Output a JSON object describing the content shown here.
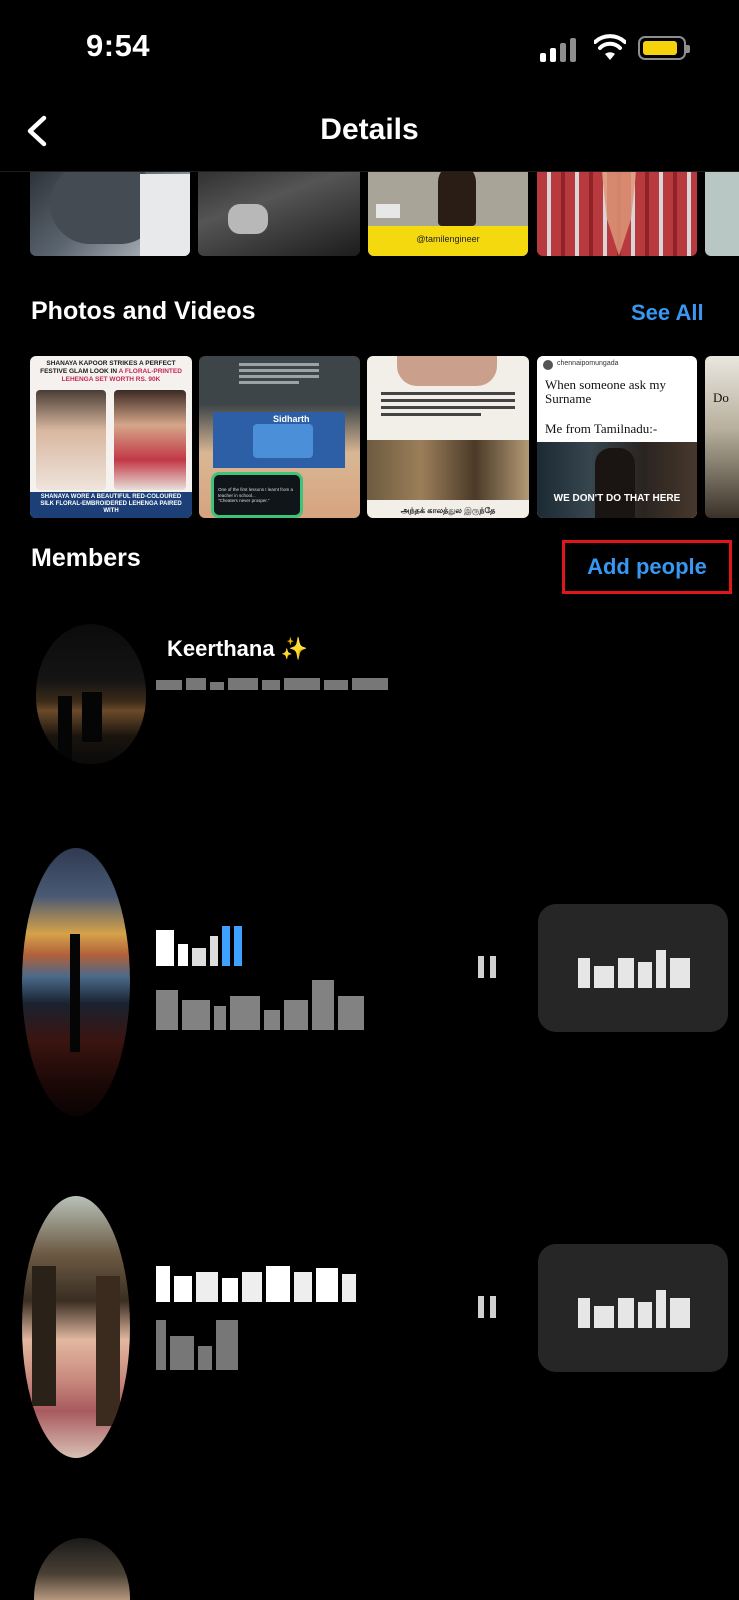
{
  "status_bar": {
    "time": "9:54",
    "battery_color": "#f5d20c"
  },
  "header": {
    "title": "Details",
    "back_icon": "chevron-left-icon"
  },
  "top_strip": {
    "items": [
      {
        "caption": ""
      },
      {
        "caption": ""
      },
      {
        "caption": "@tamilengineer"
      },
      {
        "caption": ""
      }
    ]
  },
  "photos_section": {
    "title": "Photos and Videos",
    "see_all_label": "See All",
    "items": [
      {
        "headline_1": "SHANAYA KAPOOR STRIKES A PERFECT FESTIVE GLAM LOOK IN",
        "headline_2": "A FLORAL-PRINTED LEHENGA SET WORTH RS. 90K",
        "footer": "SHANAYA WORE A BEAUTIFUL RED-COLOURED SILK FLORAL-EMBROIDERED LEHENGA PAIRED WITH"
      },
      {
        "name_label": "Sidharth",
        "tweet_text": "One of the first lessons I learnt from a teacher in school...",
        "tweet_quote": "\"Cheaters never prosper.\""
      },
      {
        "tamil_caption": "அந்தக் காலத்துல இருந்தே"
      },
      {
        "handle": "chennaipomungada",
        "line_1": "When someone ask my Surname",
        "line_2": "Me from Tamilnadu:-",
        "meme_caption": "WE DON'T DO THAT HERE"
      },
      {
        "fragment": "Do"
      }
    ]
  },
  "members_section": {
    "title": "Members",
    "add_people_label": "Add people",
    "members": [
      {
        "name": "Keerthana ✨"
      },
      {
        "name": ""
      },
      {
        "name": ""
      },
      {
        "name": ""
      }
    ]
  },
  "colors": {
    "accent": "#3897f0",
    "highlight_border": "#e0161c",
    "action_box": "#262626"
  }
}
